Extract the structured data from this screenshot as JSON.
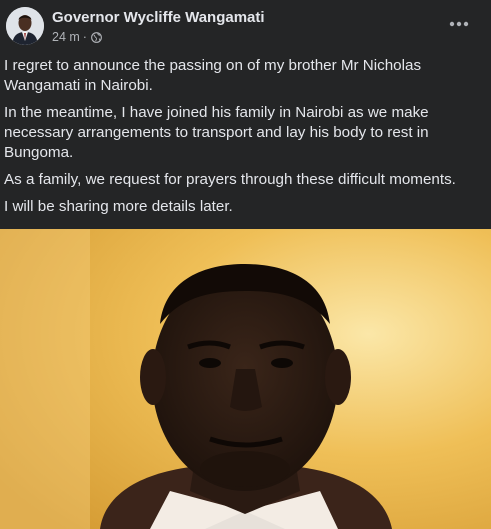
{
  "post": {
    "author": "Governor Wycliffe Wangamati",
    "time": "24 m",
    "separator": "·",
    "privacy_icon": "globe-icon",
    "more_icon": "more-options-icon",
    "paragraphs": [
      "I regret to announce the passing on of my brother Mr Nicholas Wangamati in Nairobi.",
      "In the meantime, I have joined his family in Nairobi as we make necessary arrangements to transport and lay his body to rest in Bungoma.",
      "As a family, we request for prayers through these difficult moments.",
      "I will be sharing more details later."
    ]
  },
  "colors": {
    "background": "#242526",
    "text_primary": "#e4e6eb",
    "text_secondary": "#b0b3b8",
    "photo_wall": "#e8b34a"
  }
}
